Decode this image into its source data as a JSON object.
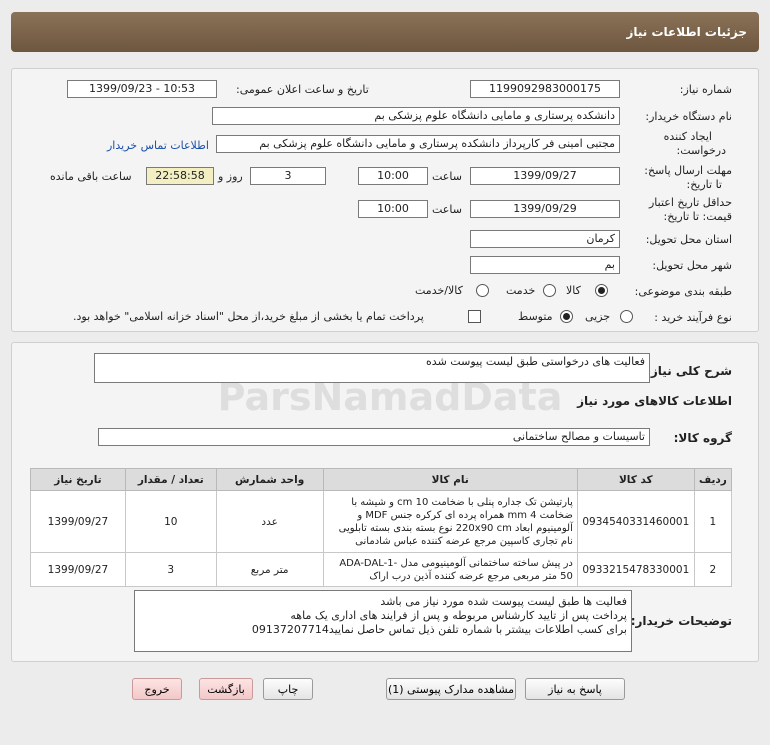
{
  "header": {
    "title": "جزئیات اطلاعات نیاز"
  },
  "form": {
    "need_number_label": "شماره نیاز:",
    "need_number": "1199092983000175",
    "announce_label": "تاریخ و ساعت اعلان عمومی:",
    "announce_value": "1399/09/23 - 10:53",
    "buyer_label": "نام دستگاه خریدار:",
    "buyer_value": "دانشکده پرستاری و مامایی دانشگاه علوم پزشکی بم",
    "creator_label_1": "ایجاد کننده",
    "creator_label_2": "درخواست:",
    "creator_value": "مجتبی امینی فر کارپرداز دانشکده پرستاری و مامایی دانشگاه علوم پزشکی بم",
    "contact_link": "اطلاعات تماس خریدار",
    "deadline_label_1": "مهلت ارسال پاسخ:",
    "deadline_label_2": "تا تاریخ:",
    "deadline_date": "1399/09/27",
    "time_label": "ساعت",
    "deadline_time": "10:00",
    "days_value": "3",
    "days_label": "روز و",
    "remaining_time": "22:58:58",
    "remaining_label": "ساعت باقی مانده",
    "validity_label_1": "حداقل تاریخ اعتبار",
    "validity_label_2": "قیمت: تا تاریخ:",
    "validity_date": "1399/09/29",
    "validity_time_label": "ساعت",
    "validity_time": "10:00",
    "province_label": "استان محل تحویل:",
    "province_value": "کرمان",
    "city_label": "شهر محل تحویل:",
    "city_value": "بم",
    "category_label": "طبقه بندی موضوعی:",
    "category_opt1": "کالا",
    "category_opt2": "خدمت",
    "category_opt3": "کالا/خدمت",
    "process_label": "نوع فرآیند خرید :",
    "process_opt1": "جزیی",
    "process_opt2": "متوسط",
    "process_note": "پرداخت تمام یا بخشی از مبلغ خرید،از محل \"اسناد خزانه اسلامی\" خواهد بود."
  },
  "summary": {
    "label": "شرح کلی نیاز:",
    "value": "فعالیت های درخواستی طبق لیست پیوست شده"
  },
  "goods": {
    "section_title": "اطلاعات کالاهای مورد نیاز",
    "group_label": "گروه کالا:",
    "group_value": "تاسیسات و مصالح ساختمانی",
    "columns": [
      "ردیف",
      "کد کالا",
      "نام کالا",
      "واحد شمارش",
      "تعداد / مقدار",
      "تاریخ نیاز"
    ],
    "rows": [
      {
        "row": "1",
        "code": "0934540331460001",
        "name": "پارتیشن تک جداره پنلی با ضخامت 10 cm و شیشه با ضخامت 4 mm همراه پرده ای کرکره جنس MDF و آلومینیوم ابعاد 220x90 cm نوع بسته بندی بسته تابلویی نام تجاری کاسپین مرجع عرضه کننده عباس شادمانی",
        "unit": "عدد",
        "qty": "10",
        "date": "1399/09/27"
      },
      {
        "row": "2",
        "code": "0933215478330001",
        "name": "در پیش ساخته ساختمانی آلومینیومی مدل ADA-DAL-1-50 متر مربعی مرجع عرضه کننده آذین درب اراک",
        "unit": "متر مربع",
        "qty": "3",
        "date": "1399/09/27"
      }
    ]
  },
  "buyer_notes": {
    "label": "توضیحات خریدار:",
    "line1": "فعالیت ها طبق لیست پیوست شده مورد نیاز می باشد",
    "line2": "پرداخت پس از تایید کارشناس مربوطه  و پس از فرایند های اداری یک ماهه",
    "line3": "برای کسب اطلاعات بیشتر با شماره تلفن ذیل تماس حاصل نمایید09137207714"
  },
  "buttons": {
    "reply": "پاسخ به نیاز",
    "attachments": "مشاهده مدارک پیوستی (1)",
    "print": "چاپ",
    "back": "بازگشت",
    "exit": "خروج"
  }
}
